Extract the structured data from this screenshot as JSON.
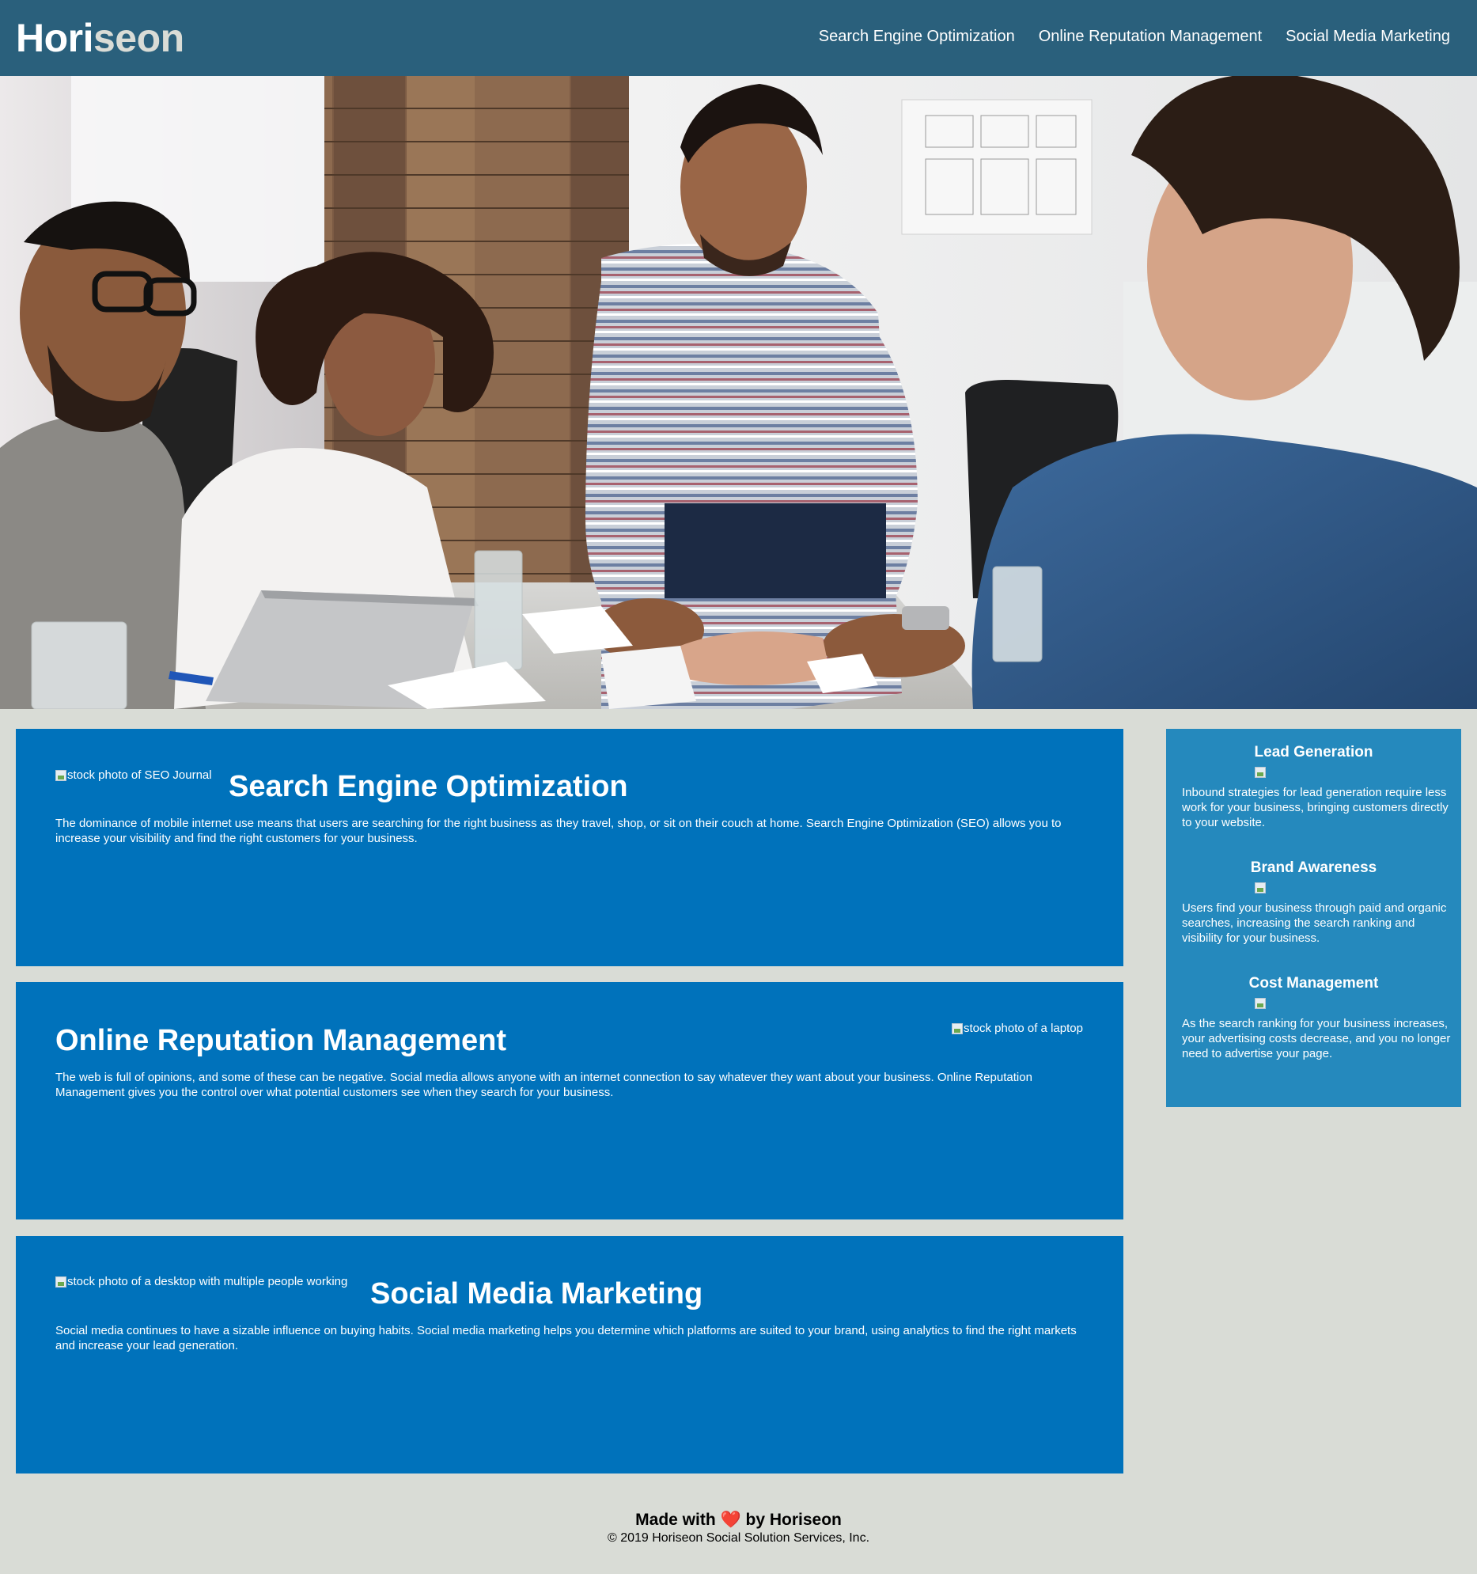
{
  "header": {
    "logo_main": "Hori",
    "logo_accent": "seon",
    "nav": [
      {
        "label": "Search Engine Optimization"
      },
      {
        "label": "Online Reputation Management"
      },
      {
        "label": "Social Media Marketing"
      }
    ]
  },
  "sections": [
    {
      "image_alt": "stock photo of SEO Journal",
      "title": "Search Engine Optimization",
      "text": "The dominance of mobile internet use means that users are searching for the right business as they travel, shop, or sit on their couch at home. Search Engine Optimization (SEO) allows you to increase your visibility and find the right customers for your business."
    },
    {
      "image_alt": "stock photo of a laptop",
      "title": "Online Reputation Management",
      "text": "The web is full of opinions, and some of these can be negative. Social media allows anyone with an internet connection to say whatever they want about your business. Online Reputation Management gives you the control over what potential customers see when they search for your business."
    },
    {
      "image_alt": "stock photo of a desktop with multiple people working",
      "title": "Social Media Marketing",
      "text": "Social media continues to have a sizable influence on buying habits. Social media marketing helps you determine which platforms are suited to your brand, using analytics to find the right markets and increase your lead generation."
    }
  ],
  "benefits": [
    {
      "title": "Lead Generation",
      "text": "Inbound strategies for lead generation require less work for your business, bringing customers directly to your website."
    },
    {
      "title": "Brand Awareness",
      "text": "Users find your business through paid and organic searches, increasing the search ranking and visibility for your business."
    },
    {
      "title": "Cost Management",
      "text": "As the search ranking for your business increases, your advertising costs decrease, and you no longer need to advertise your page."
    }
  ],
  "footer": {
    "made_prefix": "Made with",
    "heart": "❤️",
    "made_suffix": "by Horiseon",
    "copyright": "© 2019 Horiseon Social Solution Services, Inc."
  },
  "colors": {
    "header_bg": "#2a607c",
    "page_bg": "#d9dcd6",
    "section_bg": "#0072bb",
    "aside_bg": "#2589bd",
    "logo_accent": "#d9dcd6"
  }
}
